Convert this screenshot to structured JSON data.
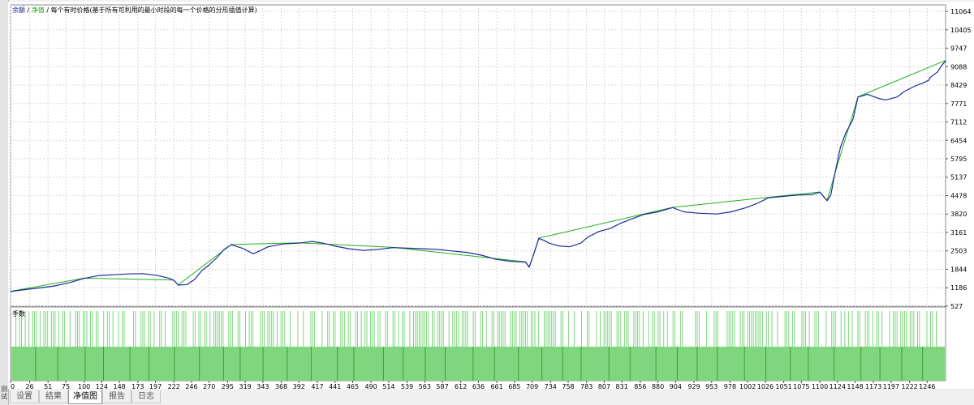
{
  "sidebar": {
    "label": "测试"
  },
  "legend": {
    "balance": "余额",
    "sep1": " / ",
    "equity": "净值",
    "rest": " / 每个有时价格(基于所有可利用的最小时段的每一个价格的分形插值计算)"
  },
  "lot_panel": {
    "label": "手数"
  },
  "tabs": [
    {
      "label": "设置",
      "active": false
    },
    {
      "label": "结果",
      "active": false
    },
    {
      "label": "净值图",
      "active": true
    },
    {
      "label": "报告",
      "active": false
    },
    {
      "label": "日志",
      "active": false
    }
  ],
  "colors": {
    "balance": "#1a2a9a",
    "equity": "#20b020",
    "lots": "#7fd67f",
    "lots_dark": "#3aa03a",
    "grid": "#d8d8d8"
  },
  "chart_data": {
    "type": "line",
    "x_axis": {
      "min": 0,
      "max": 1271,
      "ticks": [
        0,
        26,
        51,
        75,
        100,
        124,
        148,
        173,
        197,
        222,
        246,
        270,
        295,
        319,
        343,
        368,
        392,
        417,
        441,
        465,
        490,
        514,
        539,
        563,
        587,
        612,
        636,
        661,
        685,
        709,
        734,
        758,
        783,
        807,
        831,
        856,
        880,
        904,
        929,
        953,
        978,
        1002,
        1026,
        1051,
        1075,
        1100,
        1124,
        1148,
        1173,
        1197,
        1222,
        1246
      ]
    },
    "y_axis": {
      "min": 527,
      "max": 11064,
      "ticks": [
        11064,
        10405,
        9747,
        9088,
        8429,
        7771,
        7112,
        6454,
        5795,
        5137,
        4478,
        3820,
        3161,
        2503,
        1844,
        1186,
        527
      ]
    },
    "grid": true,
    "series": [
      {
        "name": "余额",
        "points": [
          [
            0,
            1050
          ],
          [
            20,
            1120
          ],
          [
            40,
            1180
          ],
          [
            60,
            1250
          ],
          [
            80,
            1370
          ],
          [
            100,
            1520
          ],
          [
            120,
            1620
          ],
          [
            140,
            1650
          ],
          [
            160,
            1680
          ],
          [
            180,
            1690
          ],
          [
            200,
            1620
          ],
          [
            215,
            1530
          ],
          [
            222,
            1450
          ],
          [
            228,
            1280
          ],
          [
            240,
            1300
          ],
          [
            250,
            1480
          ],
          [
            260,
            1800
          ],
          [
            270,
            2000
          ],
          [
            280,
            2250
          ],
          [
            290,
            2550
          ],
          [
            300,
            2720
          ],
          [
            315,
            2600
          ],
          [
            330,
            2400
          ],
          [
            340,
            2520
          ],
          [
            350,
            2650
          ],
          [
            370,
            2750
          ],
          [
            392,
            2780
          ],
          [
            410,
            2840
          ],
          [
            425,
            2780
          ],
          [
            440,
            2680
          ],
          [
            460,
            2580
          ],
          [
            480,
            2520
          ],
          [
            500,
            2560
          ],
          [
            520,
            2620
          ],
          [
            540,
            2600
          ],
          [
            560,
            2580
          ],
          [
            580,
            2560
          ],
          [
            600,
            2500
          ],
          [
            620,
            2450
          ],
          [
            640,
            2350
          ],
          [
            660,
            2200
          ],
          [
            680,
            2130
          ],
          [
            700,
            2100
          ],
          [
            705,
            1920
          ],
          [
            712,
            2450
          ],
          [
            718,
            2950
          ],
          [
            725,
            2880
          ],
          [
            732,
            2780
          ],
          [
            745,
            2680
          ],
          [
            760,
            2650
          ],
          [
            775,
            2780
          ],
          [
            785,
            3000
          ],
          [
            800,
            3200
          ],
          [
            815,
            3300
          ],
          [
            830,
            3500
          ],
          [
            845,
            3650
          ],
          [
            860,
            3800
          ],
          [
            880,
            3900
          ],
          [
            900,
            4050
          ],
          [
            915,
            3900
          ],
          [
            935,
            3850
          ],
          [
            960,
            3820
          ],
          [
            980,
            3900
          ],
          [
            1000,
            4050
          ],
          [
            1015,
            4200
          ],
          [
            1030,
            4400
          ],
          [
            1050,
            4450
          ],
          [
            1070,
            4500
          ],
          [
            1090,
            4520
          ],
          [
            1100,
            4600
          ],
          [
            1105,
            4450
          ],
          [
            1110,
            4300
          ],
          [
            1115,
            4500
          ],
          [
            1120,
            5200
          ],
          [
            1128,
            6200
          ],
          [
            1135,
            6700
          ],
          [
            1145,
            7200
          ],
          [
            1152,
            8000
          ],
          [
            1165,
            8100
          ],
          [
            1180,
            7950
          ],
          [
            1190,
            7900
          ],
          [
            1205,
            8000
          ],
          [
            1215,
            8200
          ],
          [
            1230,
            8400
          ],
          [
            1240,
            8500
          ],
          [
            1248,
            8600
          ],
          [
            1250,
            8700
          ],
          [
            1255,
            8800
          ],
          [
            1260,
            8900
          ],
          [
            1265,
            9100
          ],
          [
            1271,
            9300
          ]
        ]
      },
      {
        "name": "净值",
        "points": [
          [
            0,
            1060
          ],
          [
            100,
            1530
          ],
          [
            222,
            1460
          ],
          [
            228,
            1290
          ],
          [
            300,
            2730
          ],
          [
            392,
            2790
          ],
          [
            520,
            2630
          ],
          [
            700,
            2110
          ],
          [
            705,
            1930
          ],
          [
            712,
            2460
          ],
          [
            718,
            2960
          ],
          [
            900,
            4060
          ],
          [
            1100,
            4610
          ],
          [
            1110,
            4310
          ],
          [
            1120,
            5220
          ],
          [
            1152,
            8010
          ],
          [
            1271,
            9310
          ]
        ]
      }
    ]
  }
}
